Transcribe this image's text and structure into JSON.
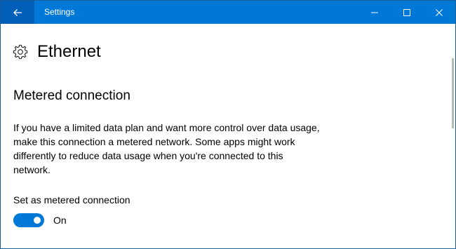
{
  "titlebar": {
    "app_title": "Settings",
    "back_icon": "back-arrow-icon",
    "controls": [
      "minimize-icon",
      "maximize-icon",
      "close-icon"
    ],
    "color": "#0078d7"
  },
  "page": {
    "icon": "gear-icon",
    "title": "Ethernet"
  },
  "section": {
    "title": "Metered connection",
    "description": "If you have a limited data plan and want more control over data usage, make this connection a metered network. Some apps might work differently to reduce data usage when you're connected to this network."
  },
  "setting": {
    "label": "Set as metered connection",
    "toggle_state": "On",
    "toggle_on": true,
    "accent": "#0078d7"
  }
}
